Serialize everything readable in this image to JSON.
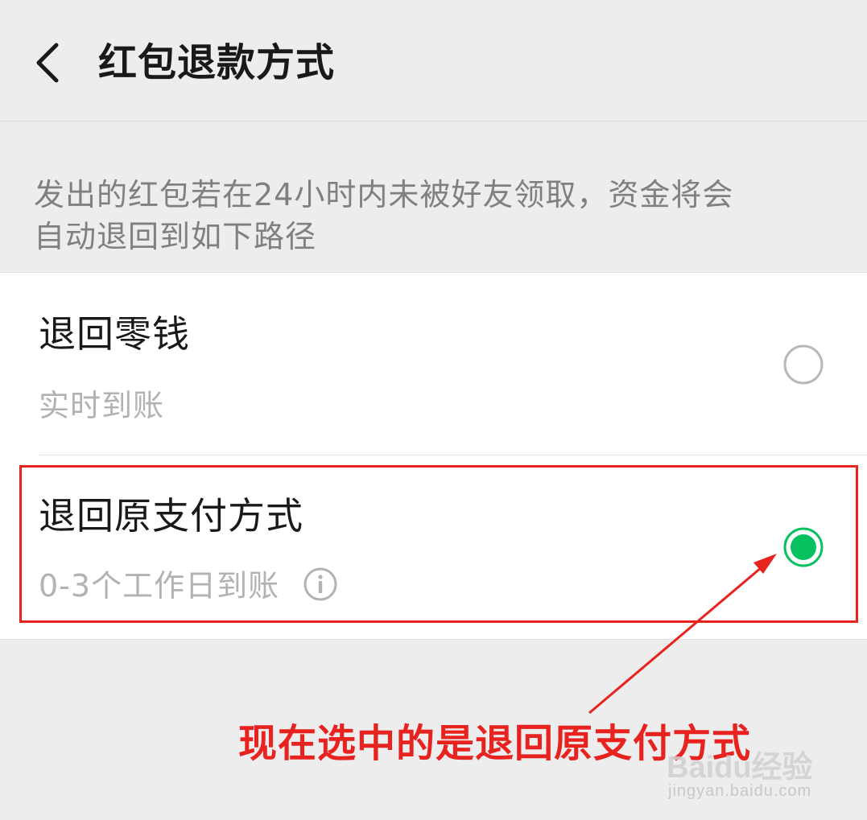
{
  "header": {
    "title": "红包退款方式"
  },
  "description": "发出的红包若在24小时内未被好友领取，资金将会自动退回到如下路径",
  "options": [
    {
      "title": "退回零钱",
      "subtitle": "实时到账",
      "selected": false
    },
    {
      "title": "退回原支付方式",
      "subtitle": "0-3个工作日到账",
      "selected": true
    }
  ],
  "annotation": {
    "text": "现在选中的是退回原支付方式"
  },
  "watermark": {
    "brand": "Baidu经验",
    "url": "jingyan.baidu.com"
  },
  "colors": {
    "accent_green": "#07c160",
    "annotation_red": "#e8231f"
  },
  "icons": [
    "back-arrow-icon",
    "radio-unchecked-icon",
    "radio-checked-icon",
    "info-icon"
  ]
}
